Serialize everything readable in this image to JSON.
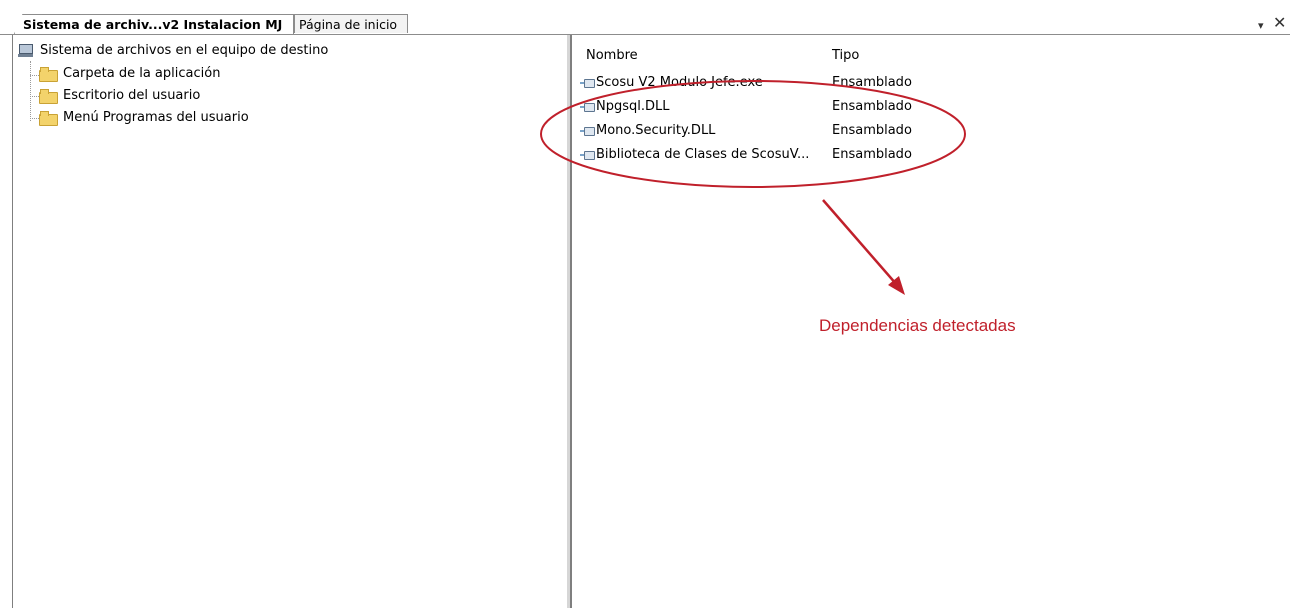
{
  "tabs": [
    {
      "label": "Sistema de archiv...v2 Instalacion MJ",
      "active": true
    },
    {
      "label": "Página de inicio",
      "active": false
    }
  ],
  "window_controls": {
    "dropdown": "▾",
    "close": "✕"
  },
  "tree": {
    "root": "Sistema de archivos en el equipo de destino",
    "children": [
      "Carpeta de la aplicación",
      "Escritorio del usuario",
      "Menú Programas del usuario"
    ]
  },
  "list": {
    "columns": {
      "name": "Nombre",
      "type": "Tipo"
    },
    "rows": [
      {
        "name": "Scosu V2 Modulo Jefe.exe",
        "type": "Ensamblado"
      },
      {
        "name": "Npgsql.DLL",
        "type": "Ensamblado"
      },
      {
        "name": "Mono.Security.DLL",
        "type": "Ensamblado"
      },
      {
        "name": "Biblioteca de Clases de ScosuV...",
        "type": "Ensamblado"
      }
    ]
  },
  "annotation": {
    "text": "Dependencias detectadas",
    "color": "#c0202b"
  }
}
